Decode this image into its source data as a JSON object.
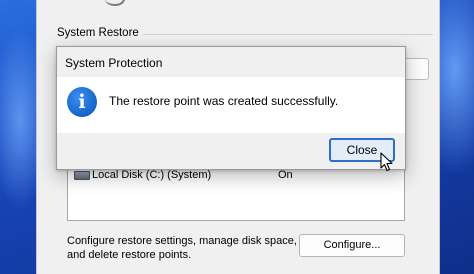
{
  "system_restore": {
    "group_label": "System Restore"
  },
  "protection": {
    "drive_name": "Local Disk (C:) (System)",
    "drive_status": "On",
    "configure_text": "Configure restore settings, manage disk space, and delete restore points.",
    "configure_button": "Configure..."
  },
  "dialog": {
    "title": "System Protection",
    "icon": "info-icon",
    "message": "The restore point was created successfully.",
    "close_button": "Close"
  },
  "colors": {
    "accent": "#2c6fcb",
    "info_icon": "#1a73d9"
  }
}
